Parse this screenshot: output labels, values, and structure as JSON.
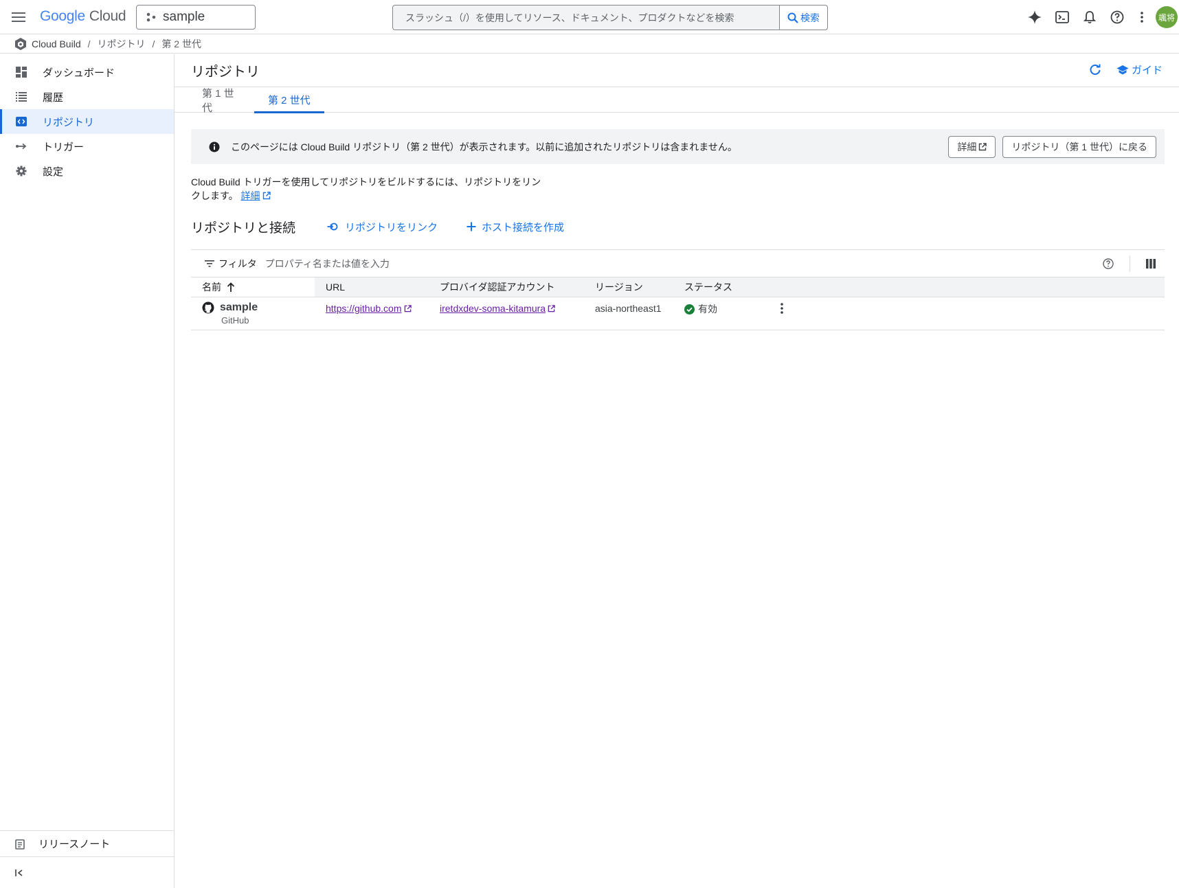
{
  "topbar": {
    "logo_google": "Google",
    "logo_cloud": "Cloud",
    "project": "sample",
    "search_placeholder": "スラッシュ（/）を使用してリソース、ドキュメント、プロダクトなどを検索",
    "search_button": "検索",
    "avatar_text": "颯将"
  },
  "breadcrumb": {
    "product": "Cloud Build",
    "items": [
      "リポジトリ",
      "第 2 世代"
    ]
  },
  "sidebar": {
    "items": [
      {
        "label": "ダッシュボード",
        "icon": "dashboard-icon"
      },
      {
        "label": "履歴",
        "icon": "list-icon"
      },
      {
        "label": "リポジトリ",
        "icon": "code-icon",
        "active": true
      },
      {
        "label": "トリガー",
        "icon": "arrow-icon"
      },
      {
        "label": "設定",
        "icon": "gear-icon"
      }
    ],
    "release_notes": "リリースノート"
  },
  "page": {
    "title": "リポジトリ",
    "guide": "ガイド",
    "tabs": [
      "第 1 世代",
      "第 2 世代"
    ],
    "active_tab": 1,
    "banner": {
      "text": "このページには Cloud Build リポジトリ（第 2 世代）が表示されます。以前に追加されたリポジトリは含まれません。",
      "details_button": "詳細",
      "back_button": "リポジトリ（第 1 世代）に戻る"
    },
    "description": "Cloud Build トリガーを使用してリポジトリをビルドするには、リポジトリをリンクします。",
    "description_link": "詳細",
    "section_title": "リポジトリと接続",
    "link_repo": "リポジトリをリンク",
    "create_host": "ホスト接続を作成"
  },
  "table": {
    "filter_label": "フィルタ",
    "filter_placeholder": "プロパティ名または値を入力",
    "columns": [
      "名前",
      "URL",
      "プロバイダ認証アカウント",
      "リージョン",
      "ステータス"
    ],
    "rows": [
      {
        "name": "sample",
        "provider": "GitHub",
        "url": "https://github.com",
        "account": "iretdxdev-soma-kitamura",
        "region": "asia-northeast1",
        "status": "有効"
      }
    ]
  },
  "colors": {
    "accent": "#1a73e8",
    "active_nav_bg": "#e8f0fe",
    "visited_link": "#681da8",
    "status_ok": "#188038",
    "avatar": "#6ba53e"
  }
}
